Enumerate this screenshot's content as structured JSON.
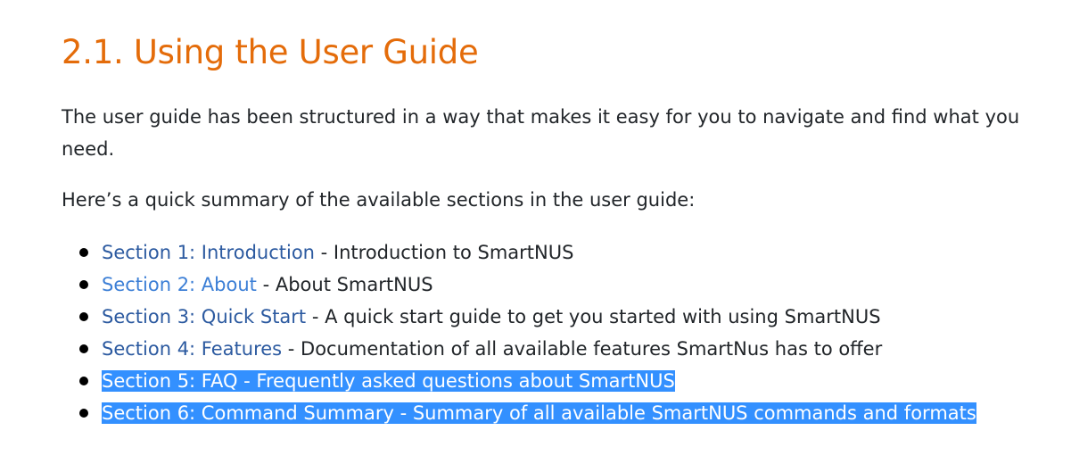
{
  "heading": "2.1. Using the User Guide",
  "intro": "The user guide has been structured in a way that makes it easy for you to navigate and find what you need.",
  "summary": "Here’s a quick summary of the available sections in the user guide:",
  "sections": [
    {
      "link": "Section 1: Introduction",
      "desc": " - Introduction to SmartNUS"
    },
    {
      "link": "Section 2: About",
      "desc": " - About SmartNUS"
    },
    {
      "link": "Section 3: Quick Start",
      "desc": " - A quick start guide to get you started with using SmartNUS"
    },
    {
      "link": "Section 4: Features",
      "desc": " - Documentation of all available features SmartNus has to offer"
    },
    {
      "link": "Section 5: FAQ",
      "desc": " - Frequently asked questions about SmartNUS "
    },
    {
      "link": "Section 6: Command Summary",
      "desc": " - Summary of all available SmartNUS commands and formats"
    }
  ],
  "colors": {
    "heading": "#e46c0a",
    "link": "#2c5aa0",
    "selection": "#3390ff"
  }
}
